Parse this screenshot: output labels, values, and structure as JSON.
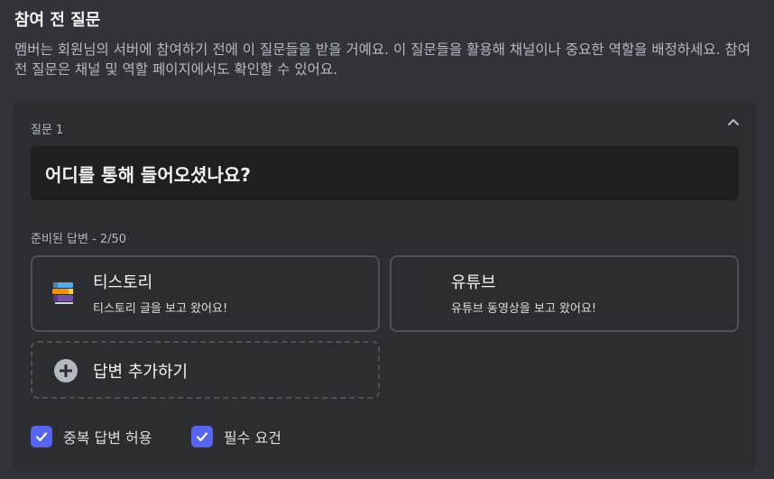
{
  "section": {
    "title": "참여 전 질문",
    "description": "멤버는 회원님의 서버에 참여하기 전에 이 질문들을 받을 거예요. 이 질문들을 활용해 채널이나 중요한 역할을 배정하세요. 참여 전 질문은 채널 및 역할 페이지에서도 확인할 수 있어요."
  },
  "question": {
    "label": "질문 1",
    "text": "어디를 통해 들어오셨나요?",
    "answers_label": "준비된 답변 - 2/50",
    "answers": [
      {
        "title": "티스토리",
        "description": "티스토리 글을 보고 왔어요!",
        "icon": "books-emoji-icon"
      },
      {
        "title": "유튜브",
        "description": "유튜브 동영상을 보고 왔어요!"
      }
    ],
    "add_answer_label": "답변 추가하기",
    "options": [
      {
        "label": "중복 답변 허용",
        "checked": true
      },
      {
        "label": "필수 요건",
        "checked": true
      }
    ]
  },
  "colors": {
    "background": "#313338",
    "card": "#2b2d31",
    "input": "#1e1f22",
    "accent": "#5865f2"
  }
}
